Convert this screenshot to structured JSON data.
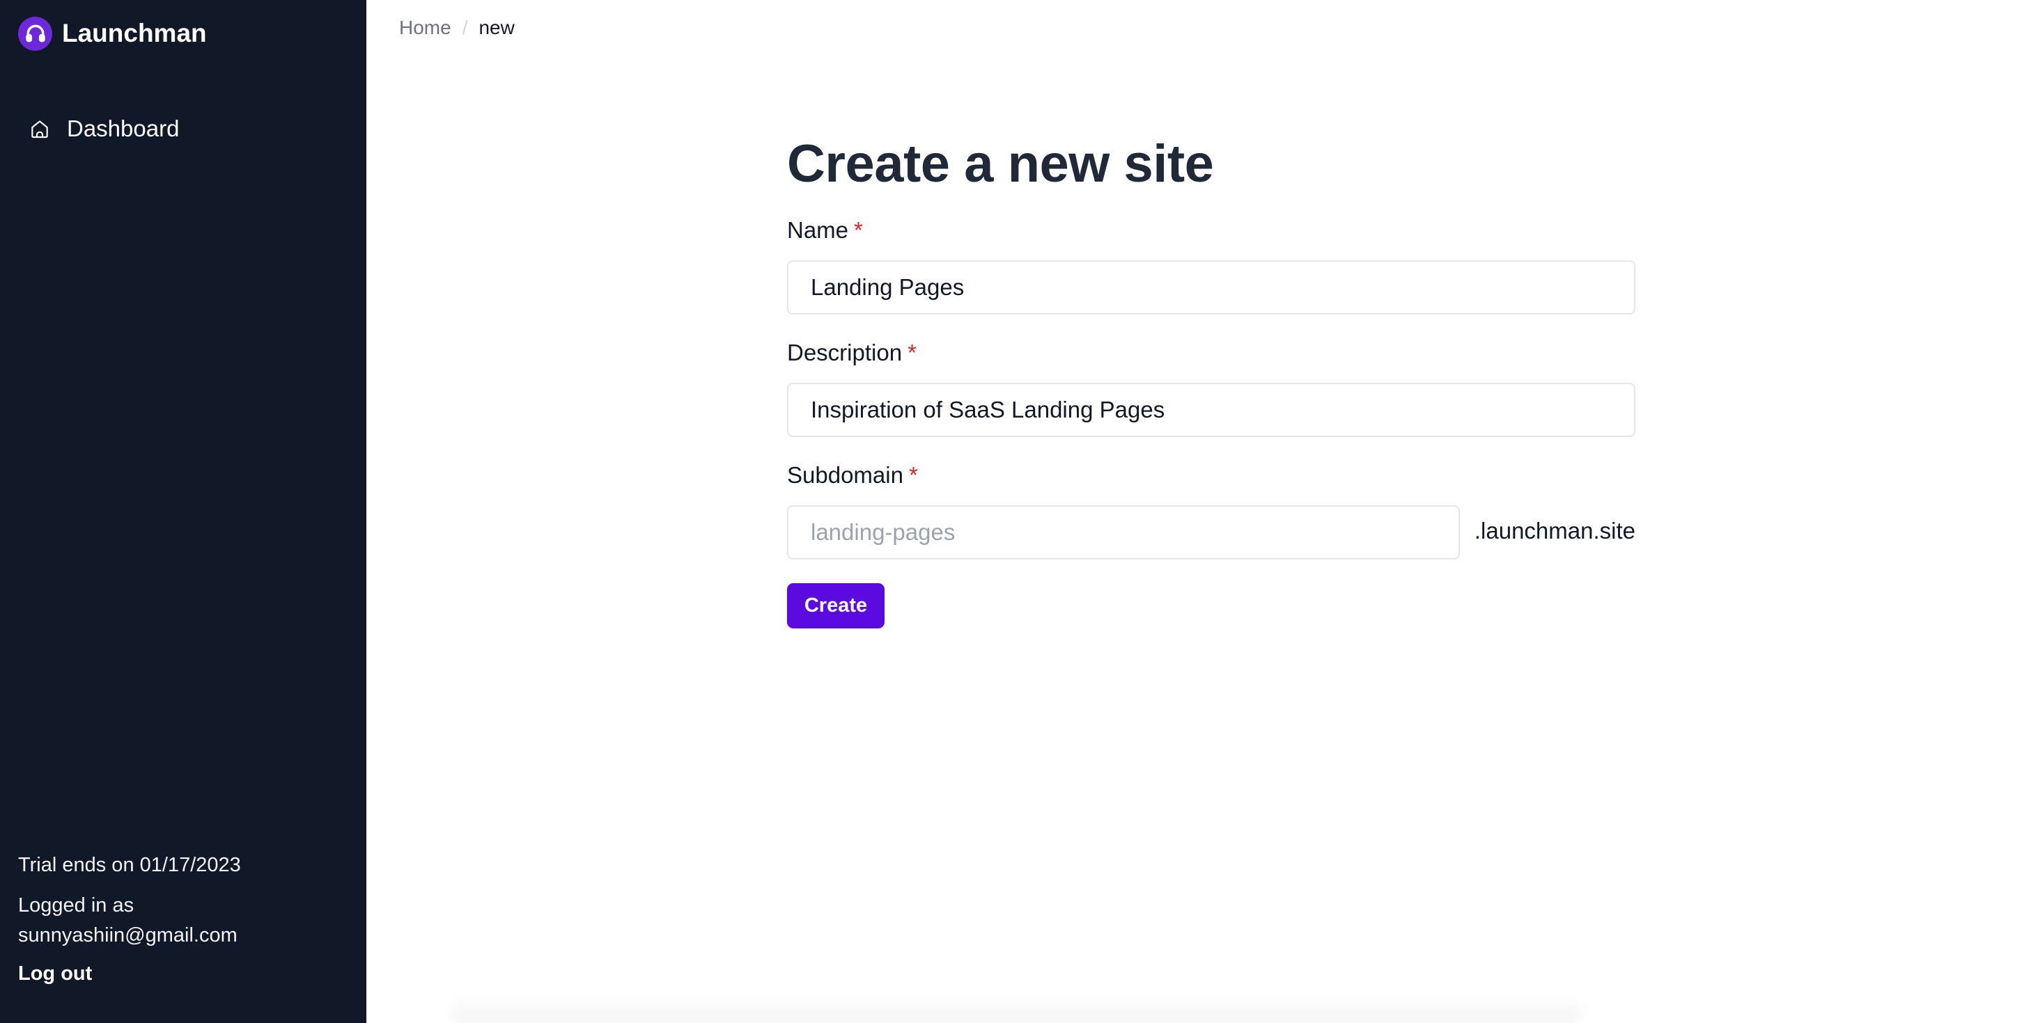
{
  "brand": {
    "name": "Launchman",
    "logo_icon": "headphones-icon",
    "accent": "#6d28d9"
  },
  "sidebar": {
    "items": [
      {
        "label": "Dashboard",
        "icon": "home-icon"
      }
    ],
    "trial_text": "Trial ends on 01/17/2023",
    "logged_in_label": "Logged in as",
    "logged_in_email": "sunnyashiin@gmail.com",
    "logout_label": "Log out"
  },
  "breadcrumb": {
    "home": "Home",
    "separator": "/",
    "current": "new"
  },
  "form": {
    "title": "Create a new site",
    "required_mark": "*",
    "name": {
      "label": "Name",
      "value": "Landing Pages"
    },
    "description": {
      "label": "Description",
      "value": "Inspiration of SaaS Landing Pages"
    },
    "subdomain": {
      "label": "Subdomain",
      "value": "",
      "placeholder": "landing-pages",
      "suffix": ".launchman.site"
    },
    "submit_label": "Create",
    "submit_color": "#5b0be0"
  }
}
